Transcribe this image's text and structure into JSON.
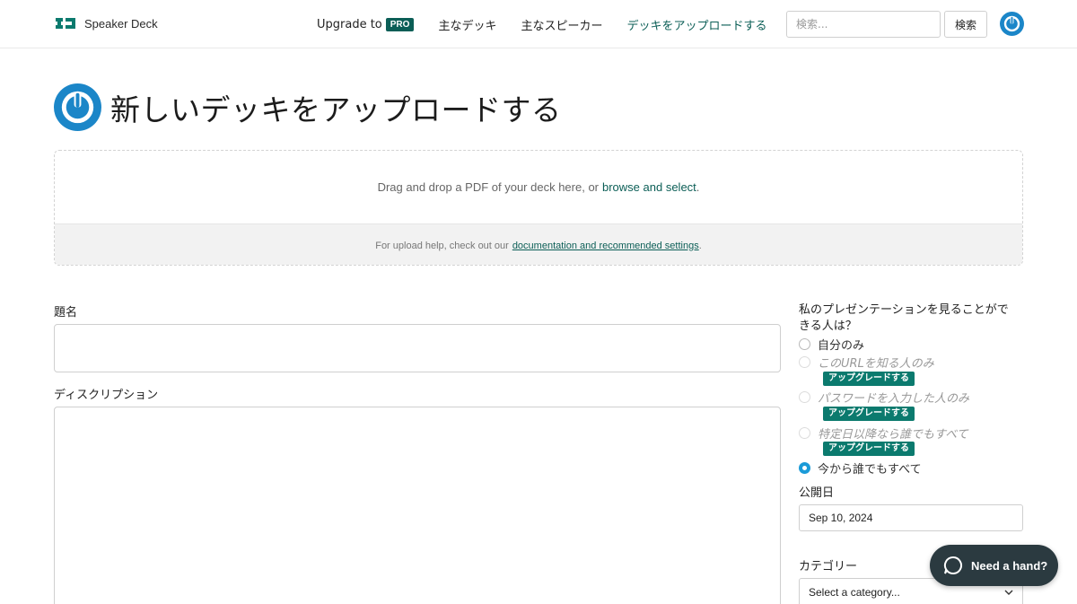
{
  "header": {
    "logo_text": "Speaker Deck",
    "nav": {
      "upgrade_label": "Upgrade to",
      "pro_badge": "PRO",
      "featured_decks": "主なデッキ",
      "featured_speakers": "主なスピーカー",
      "upload_deck": "デッキをアップロードする"
    },
    "search": {
      "placeholder": "検索...",
      "button_label": "検索"
    }
  },
  "page": {
    "title": "新しいデッキをアップロードする"
  },
  "dropzone": {
    "text": "Drag and drop a PDF of your deck here, or",
    "browse_link": "browse and select",
    "browse_suffix": ".",
    "help_prefix": "For upload help, check out our",
    "help_link": "documentation and recommended settings",
    "help_suffix": "."
  },
  "form": {
    "title_label": "題名",
    "description_label": "ディスクリプション"
  },
  "privacy": {
    "label": "私のプレゼンテーションを見ることができる人は？",
    "options": [
      {
        "label": "自分のみ",
        "disabled": false,
        "checked": false
      },
      {
        "label": "このURLを知る人のみ",
        "disabled": true,
        "checked": false,
        "upgrade": "アップグレードする"
      },
      {
        "label": "パスワードを入力した人のみ",
        "disabled": true,
        "checked": false,
        "upgrade": "アップグレードする"
      },
      {
        "label": "特定日以降なら誰でもすべて",
        "disabled": true,
        "checked": false,
        "upgrade": "アップグレードする"
      },
      {
        "label": "今から誰でもすべて",
        "disabled": false,
        "checked": true
      }
    ]
  },
  "publish": {
    "label": "公開日",
    "value": "Sep 10, 2024"
  },
  "category": {
    "label": "カテゴリー",
    "selected": "Select a category..."
  },
  "help_widget": {
    "label": "Need a hand?"
  },
  "colors": {
    "brand": "#0b5e56",
    "accent_blue": "#1b9bd8",
    "widget_bg": "#2b3a40"
  }
}
